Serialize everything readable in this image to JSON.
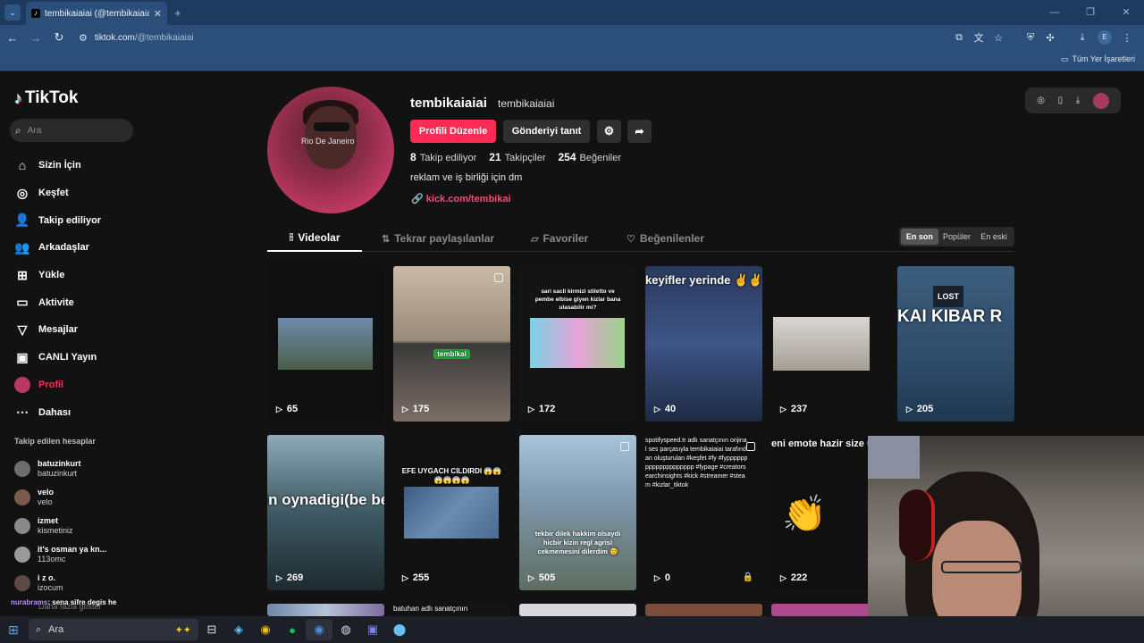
{
  "browser": {
    "tab_title": "tembikaiaiai (@tembikaiaiai) | T",
    "url_host": "tiktok.com",
    "url_path": "/@tembikaiaiai",
    "profile_letter": "E",
    "bookmarks_all": "Tüm Yer İşaretleri"
  },
  "sidebar": {
    "logo": "TikTok",
    "search_placeholder": "Ara",
    "nav": [
      {
        "label": "Sizin İçin",
        "icon": "home-icon"
      },
      {
        "label": "Keşfet",
        "icon": "compass-icon"
      },
      {
        "label": "Takip ediliyor",
        "icon": "user-check-icon"
      },
      {
        "label": "Arkadaşlar",
        "icon": "friends-icon"
      },
      {
        "label": "Yükle",
        "icon": "upload-icon"
      },
      {
        "label": "Aktivite",
        "icon": "activity-icon"
      },
      {
        "label": "Mesajlar",
        "icon": "send-icon"
      },
      {
        "label": "CANLI Yayın",
        "icon": "live-icon"
      },
      {
        "label": "Profil",
        "icon": "profile-avatar"
      },
      {
        "label": "Dahası",
        "icon": "more-dots-icon"
      }
    ],
    "following_header": "Takip edilen hesaplar",
    "following": [
      {
        "name": "batuzinkurt",
        "sub": "batuzinkurt"
      },
      {
        "name": "velo",
        "sub": "velo"
      },
      {
        "name": "izmet",
        "sub": "kismetiniz"
      },
      {
        "name": "it's osman ya kn...",
        "sub": "113omc"
      },
      {
        "name": "i z o.",
        "sub": "izocum"
      }
    ],
    "more_following": "Daha fazla göster",
    "chat_user": "nurabrams",
    "chat_msg": ": sena sifre degis he"
  },
  "profile": {
    "avatar_text": "Rio De Janeiro",
    "username": "tembikaiaiai",
    "nickname": "tembikaiaiai",
    "edit_label": "Profili Düzenle",
    "promote_label": "Gönderiyi tanıt",
    "stats": [
      {
        "value": "8",
        "label": "Takip ediliyor"
      },
      {
        "value": "21",
        "label": "Takipçiler"
      },
      {
        "value": "254",
        "label": "Beğeniler"
      }
    ],
    "bio": "reklam ve iş birliği için dm",
    "link": "kick.com/tembikai"
  },
  "tabs": [
    {
      "label": "Videolar",
      "icon": "grid-icon"
    },
    {
      "label": "Tekrar paylaşılanlar",
      "icon": "repost-icon"
    },
    {
      "label": "Favoriler",
      "icon": "bookmark-icon"
    },
    {
      "label": "Beğenilenler",
      "icon": "heart-icon"
    }
  ],
  "sort": [
    "En son",
    "Popüler",
    "En eski"
  ],
  "videos": [
    {
      "views": "65",
      "caption": ""
    },
    {
      "views": "175",
      "caption": "tembikai"
    },
    {
      "views": "172",
      "caption": "sari sacli kirmizi stiletto ve pembe elbise giyen kizlar bana ulasabilir mi?"
    },
    {
      "views": "40",
      "caption": "keyifler yerinde ✌️✌️"
    },
    {
      "views": "237",
      "caption": ""
    },
    {
      "views": "205",
      "caption": "KAI KIBAR R"
    },
    {
      "views": "269",
      "caption": "nin oynadigi(be ber) demo deniy gelin kizlar ✌️✌️"
    },
    {
      "views": "255",
      "caption": "EFE UYGACH CILDIRDI 😱😱 😱😱😱😱"
    },
    {
      "views": "505",
      "caption": "tekbir dilek hakkim olsaydi hicbir kizin regl agrisi cekmemesini dilerdim 😊"
    },
    {
      "views": "0",
      "caption": "spotifyspeed.tr adlı sanatçının orijinal ses parçasıyla tembikaiaiai tarafından oluşturulan #keşfet #fy #fypppppppppppppppppppp #fypage #creatorsearchinsights #kick #streamer #steam #kizlar_tiktok"
    },
    {
      "views": "222",
      "caption": "eni emote hazir size uzel? emoteu kullan erseniz abone olab kick:tembikai"
    }
  ],
  "bottom_peek_caption": "batuhan adlı sanatçının",
  "taskbar": {
    "search": "Ara"
  },
  "colors": {
    "accent": "#fe2c55",
    "bg": "#121212",
    "chrome": "#2b4e7a"
  }
}
